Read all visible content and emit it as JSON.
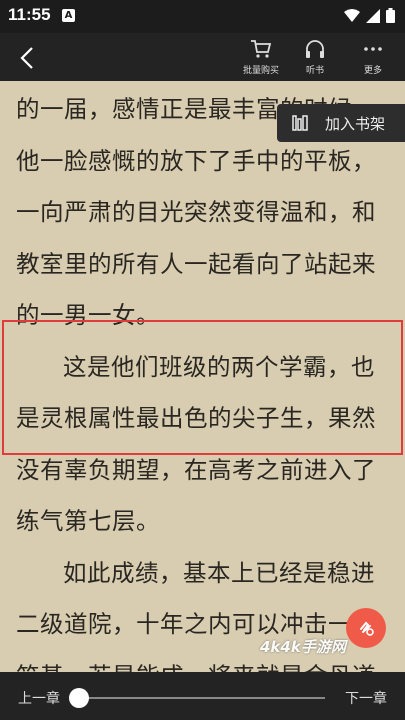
{
  "status_bar": {
    "time": "11:55",
    "notification_badge": "A"
  },
  "toolbar": {
    "buy_label": "批量购买",
    "listen_label": "听书",
    "more_label": "更多",
    "bookmark_label": "加入书架"
  },
  "content": {
    "paragraphs": [
      "的一届，感情正是最丰富的时候。",
      "他一脸感慨的放下了手中的平板，一向严肃的目光突然变得温和，和教室里的所有人一起看向了站起来的一男一女。",
      "这是他们班级的两个学霸，也是灵根属性最出色的尖子生，果然没有辜负期望，在高考之前进入了练气第七层。",
      "如此成绩，基本上已经是稳进二级道院，十年之内可以冲击一次筑基，若是能成，将来就是金丹道"
    ]
  },
  "bottom_bar": {
    "prev_label": "上一章",
    "next_label": "下一章",
    "progress": 0.0
  },
  "watermark": "4k4k手游网",
  "colors": {
    "page_bg": "#d8cdb0",
    "bar_bg": "#232323",
    "highlight": "#e03c3c",
    "fab": "#f05a48"
  }
}
